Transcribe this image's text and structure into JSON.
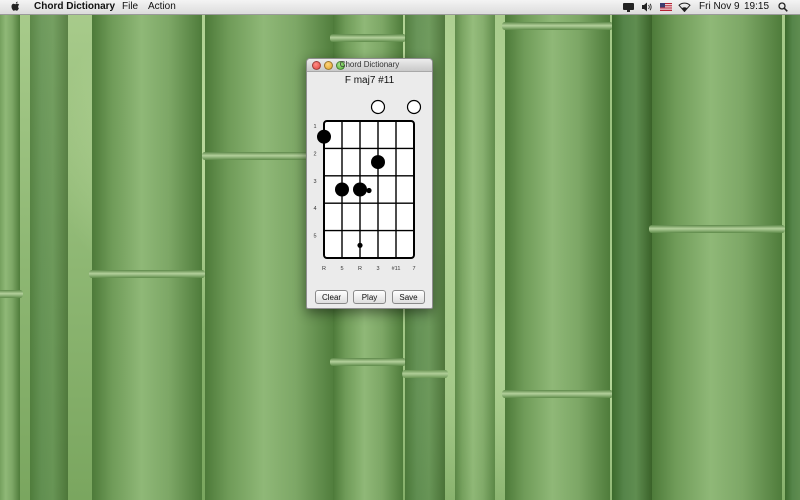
{
  "menubar": {
    "app_name": "Chord Dictionary",
    "menus": [
      "File",
      "Action"
    ],
    "clock_day": "Fri Nov 9",
    "clock_time": "19:15",
    "status_icons": [
      "display-icon",
      "volume-icon",
      "us-flag-icon",
      "wifi-icon",
      "spotlight-search-icon"
    ]
  },
  "window": {
    "title": "Chord Dictionary",
    "chord_name": "F maj7  #11",
    "fret_numbers": [
      "1",
      "2",
      "3",
      "4",
      "5"
    ],
    "interval_labels": [
      "R",
      "5",
      "R",
      "3",
      "#11",
      "7"
    ],
    "open_strings": [
      "3",
      "7"
    ],
    "fingering": [
      {
        "string": 1,
        "fret": 1,
        "kind": "finger"
      },
      {
        "string": 2,
        "fret": 3,
        "kind": "finger"
      },
      {
        "string": 3,
        "fret": 3,
        "kind": "finger"
      },
      {
        "string": 4,
        "fret": 2,
        "kind": "finger"
      },
      {
        "string": 3,
        "fret": 3,
        "kind": "small",
        "offset": "right"
      },
      {
        "string": 3,
        "fret": 5,
        "kind": "small"
      }
    ],
    "buttons": {
      "clear": "Clear",
      "play": "Play",
      "save": "Save"
    }
  }
}
